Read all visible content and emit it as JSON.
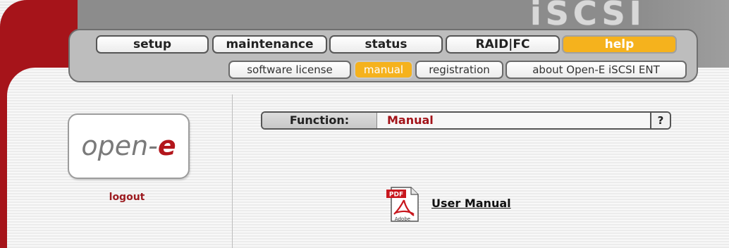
{
  "branding": {
    "product_logo": "iSCSI",
    "company_logo_main": "open-",
    "company_logo_accent": "e"
  },
  "nav": {
    "tabs": [
      {
        "label": "setup",
        "active": false
      },
      {
        "label": "maintenance",
        "active": false
      },
      {
        "label": "status",
        "active": false
      },
      {
        "label": "RAID|FC",
        "active": false
      },
      {
        "label": "help",
        "active": true
      }
    ],
    "subtabs": [
      {
        "label": "software license",
        "active": false
      },
      {
        "label": "manual",
        "active": true
      },
      {
        "label": "registration",
        "active": false
      },
      {
        "label": "about Open-E iSCSI ENT",
        "active": false
      }
    ]
  },
  "sidebar": {
    "logout_label": "logout"
  },
  "function_bar": {
    "label": "Function:",
    "value": "Manual",
    "help_label": "?"
  },
  "content": {
    "pdf_icon_top": "PDF",
    "pdf_icon_bottom": "Adobe",
    "manual_link": "User Manual"
  },
  "colors": {
    "accent_orange": "#f5b21d",
    "brand_red": "#a6141a",
    "header_gray": "#8c8c8c"
  },
  "icons": [
    "pdf-icon"
  ]
}
